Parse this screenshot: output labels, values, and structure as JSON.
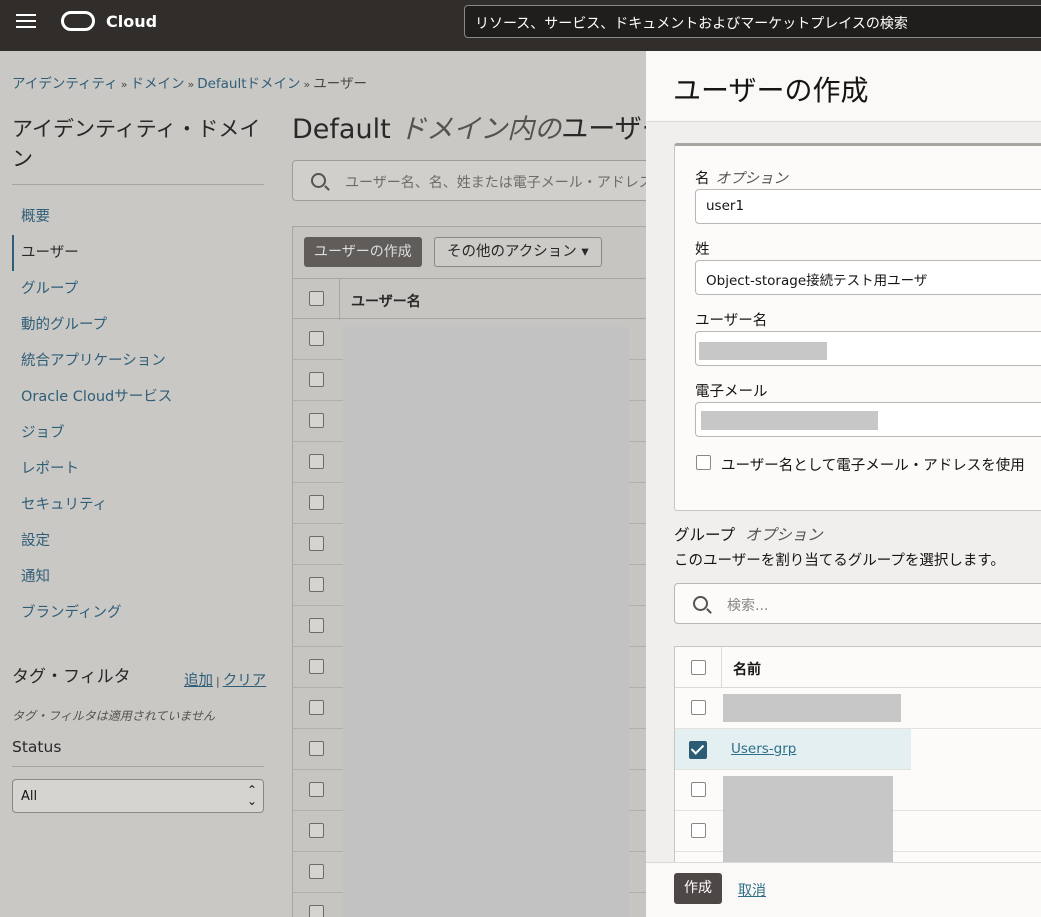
{
  "header": {
    "brand": "Cloud",
    "search_placeholder": "リソース、サービス、ドキュメントおよびマーケットプレイスの検索"
  },
  "breadcrumb": {
    "items": [
      "アイデンティティ",
      "ドメイン",
      "Defaultドメイン"
    ],
    "current": "ユーザー",
    "separator": "»"
  },
  "sidebar": {
    "title": "アイデンティティ・ドメイン",
    "items": [
      "概要",
      "ユーザー",
      "グループ",
      "動的グループ",
      "統合アプリケーション",
      "Oracle Cloudサービス",
      "ジョブ",
      "レポート",
      "セキュリティ",
      "設定",
      "通知",
      "ブランディング"
    ],
    "active_item": "ユーザー",
    "tag_filter": {
      "title": "タグ・フィルタ",
      "add_label": "追加",
      "separator": "|",
      "clear_label": "クリア",
      "empty_text": "タグ・フィルタは適用されていません"
    },
    "status": {
      "label": "Status",
      "selected": "All"
    }
  },
  "main": {
    "title_prefix": "Default",
    "title_italic": "ドメイン内の",
    "title_suffix": "ユーザー",
    "search_placeholder": "ユーザー名、名、姓または電子メール・アドレス",
    "create_user_button": "ユーザーの作成",
    "more_actions_button": "その他のアクション",
    "column_username": "ユーザー名"
  },
  "drawer": {
    "title": "ユーザーの作成",
    "first_name": {
      "label": "名",
      "optional": "オプション",
      "value": "user1"
    },
    "last_name": {
      "label": "姓",
      "value": "Object-storage接続テスト用ユーザ"
    },
    "username": {
      "label": "ユーザー名"
    },
    "email": {
      "label": "電子メール"
    },
    "use_email_as_username": {
      "label": "ユーザー名として電子メール・アドレスを使用",
      "checked": false
    },
    "groups": {
      "label": "グループ",
      "optional": "オプション",
      "description": "このユーザーを割り当てるグループを選択します。",
      "search_placeholder": "検索...",
      "column_name": "名前",
      "selected_group": "Users-grp"
    },
    "create_button": "作成",
    "cancel_button": "取消"
  },
  "colors": {
    "topbar": "#312d2a",
    "link": "#2f6e86",
    "primary_button": "#4d4845",
    "checkbox_checked": "#2c5c75"
  }
}
